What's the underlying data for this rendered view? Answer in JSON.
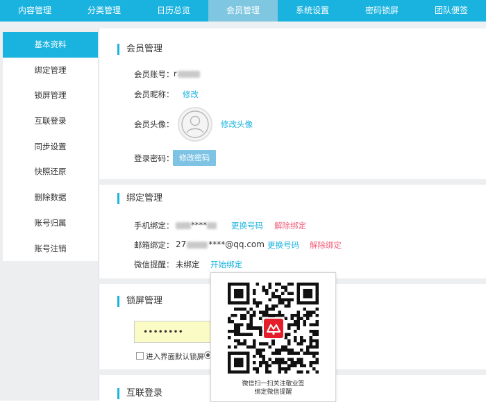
{
  "topnav": [
    "内容管理",
    "分类管理",
    "日历总览",
    "会员管理",
    "系统设置",
    "密码锁屏",
    "团队便签"
  ],
  "active_tab_index": 3,
  "sidebar": [
    "基本资料",
    "绑定管理",
    "锁屏管理",
    "互联登录",
    "同步设置",
    "快照还原",
    "删除数据",
    "账号归属",
    "账号注销"
  ],
  "member": {
    "title": "会员管理",
    "account_label": "会员账号：",
    "account_prefix": "r",
    "nickname_label": "会员昵称：",
    "nickname_edit": "修改",
    "avatar_label": "会员头像：",
    "avatar_edit": "修改头像",
    "password_label": "登录密码：",
    "password_button": "修改密码"
  },
  "binding": {
    "title": "绑定管理",
    "phone_label": "手机绑定：",
    "phone_mask": "****",
    "phone_change": "更换号码",
    "phone_unbind": "解除绑定",
    "email_label": "邮箱绑定：",
    "email_prefix": "27",
    "email_suffix": "****@qq.com",
    "email_change": "更换号码",
    "email_unbind": "解除绑定",
    "wechat_label": "微信提醒：",
    "wechat_status": "未绑定",
    "wechat_bind": "开始绑定"
  },
  "lock": {
    "title": "锁屏管理",
    "password_value": "••••••••",
    "default_lock_label": "进入界面默认锁屏"
  },
  "connect": {
    "title": "互联登录"
  },
  "qr_popup": {
    "caption_line1": "微信扫一扫关注敬业签",
    "caption_line2": "绑定微信提醒"
  },
  "colors": {
    "accent": "#1ab3df",
    "active_tab": "#7fc7e0",
    "danger": "#f0607a",
    "logo_red": "#e51d2a"
  }
}
